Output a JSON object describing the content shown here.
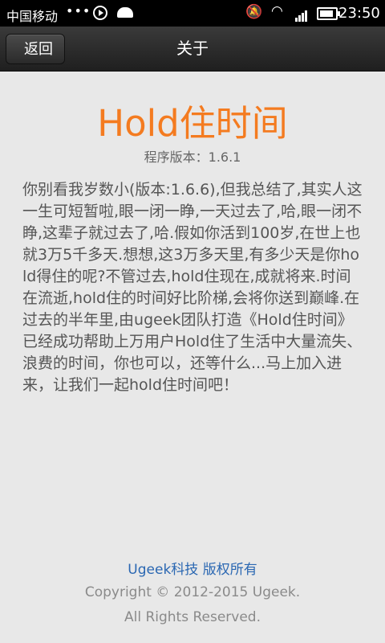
{
  "status_bar": {
    "carrier": "中国移动",
    "dots": "•••",
    "time": "23:50",
    "icons": [
      "play-icon",
      "android-icon",
      "mute-icon",
      "wifi-icon",
      "signal-icon",
      "battery-icon"
    ]
  },
  "header": {
    "back_label": "返回",
    "title": "关于"
  },
  "about": {
    "app_name": "Hold住时间",
    "version": "程序版本：1.6.1",
    "description": "你别看我岁数小(版本:1.6.6),但我总结了,其实人这一生可短暂啦,眼一闭一睁,一天过去了,哈,眼一闭不睁,这辈子就过去了,哈.假如你活到100岁,在世上也就3万5千多天.想想,这3万多天里,有多少天是你hold得住的呢?不管过去,hold住现在,成就将来.时间在流逝,hold住的时间好比阶梯,会将你送到巅峰.在过去的半年里,由ugeek团队打造《Hold住时间》已经成功帮助上万用户Hold住了生活中大量流失、浪费的时间，你也可以，还等什么...马上加入进来，让我们一起hold住时间吧！",
    "company": "Ugeek科技 版权所有",
    "copyright": "Copyright © 2012-2015 Ugeek.",
    "rights": "All Rights Reserved."
  },
  "colors": {
    "accent": "#f47b20",
    "link": "#2a67b2",
    "background": "#e8e8e8"
  }
}
